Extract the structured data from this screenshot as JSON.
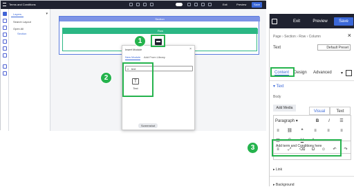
{
  "app": {
    "window_title": "Terms and Conditions",
    "exit_label": "Exit",
    "preview_label": "Preview",
    "save_label": "Save"
  },
  "layers": {
    "tab_label": "Layers",
    "items": [
      "Search Layout",
      "Open All",
      "Section"
    ]
  },
  "canvas": {
    "section_label": "Section",
    "row_label": "Row",
    "insert_icon_glyph": "▬"
  },
  "insert_modal": {
    "title": "Insert Module",
    "tabs": [
      "New Module",
      "Add From Library"
    ],
    "search_value": "text",
    "module_label": "Text",
    "screenshot_label": "Screenshot"
  },
  "panel": {
    "exit_label": "Exit",
    "preview_label": "Preview",
    "save_label": "Save",
    "breadcrumb": "Page › Section › Row › Column",
    "text_label": "Text",
    "preset_label": "Default Preset",
    "tabs": [
      "Content",
      "Design",
      "Advanced"
    ],
    "section_title": "Text",
    "body_label": "Body",
    "add_media_label": "Add Media",
    "editor_tabs": [
      "Visual",
      "Text"
    ],
    "format_select": "Paragraph",
    "editor_content": "Add term and Conditions here",
    "accordions": [
      "Link",
      "Background"
    ]
  },
  "annotations": {
    "badges": [
      "1",
      "2",
      "3"
    ],
    "highlight_color": "#25b34d"
  },
  "colors": {
    "accent": "#3b68d8",
    "row_green": "#2bb784",
    "section_blue": "#7d93e6",
    "dark_bar": "#1f2230"
  }
}
